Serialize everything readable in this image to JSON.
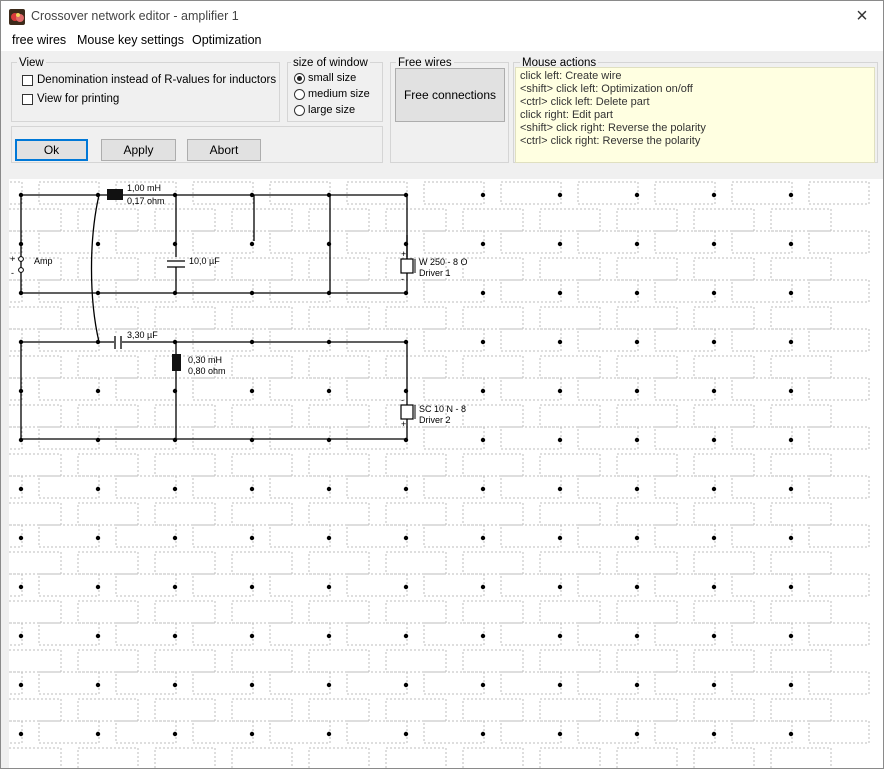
{
  "window": {
    "title": "Crossover network editor - amplifier 1",
    "close_glyph": "×"
  },
  "menu": [
    "free wires",
    "Mouse key settings",
    "Optimization"
  ],
  "view_group": {
    "legend": "View",
    "options": [
      {
        "label": "Denomination instead of R-values for inductors",
        "checked": false
      },
      {
        "label": "View for printing",
        "checked": false
      }
    ]
  },
  "size_group": {
    "legend": "size of window",
    "options": [
      {
        "label": "small size",
        "selected": true
      },
      {
        "label": "medium size",
        "selected": false
      },
      {
        "label": "large size",
        "selected": false
      }
    ]
  },
  "free_wires_group": {
    "legend": "Free wires",
    "button": "Free connections"
  },
  "mouse_actions": {
    "legend": "Mouse actions",
    "lines": [
      "click left: Create wire",
      "<shift> click left: Optimization on/off",
      "<ctrl> click left: Delete part",
      "click right: Edit part",
      "<shift> click right: Reverse the polarity",
      "<ctrl> click right: Reverse the polarity"
    ]
  },
  "buttons": {
    "ok": "Ok",
    "apply": "Apply",
    "abort": "Abort"
  },
  "circuit": {
    "amp_label": "Amp",
    "plus": "+",
    "minus": "-",
    "inductor1_value": "1,00 mH",
    "inductor1_resistance": "0,17 ohm",
    "capacitor1_value": "10,0 µF",
    "driver1_model": "W 250 - 8 O",
    "driver1_name": "Driver 1",
    "capacitor2_value": "3,30 µF",
    "inductor2_value": "0,30 mH",
    "inductor2_resistance": "0,80 ohm",
    "driver2_model": "SC 10 N - 8",
    "driver2_name": "Driver 2"
  }
}
